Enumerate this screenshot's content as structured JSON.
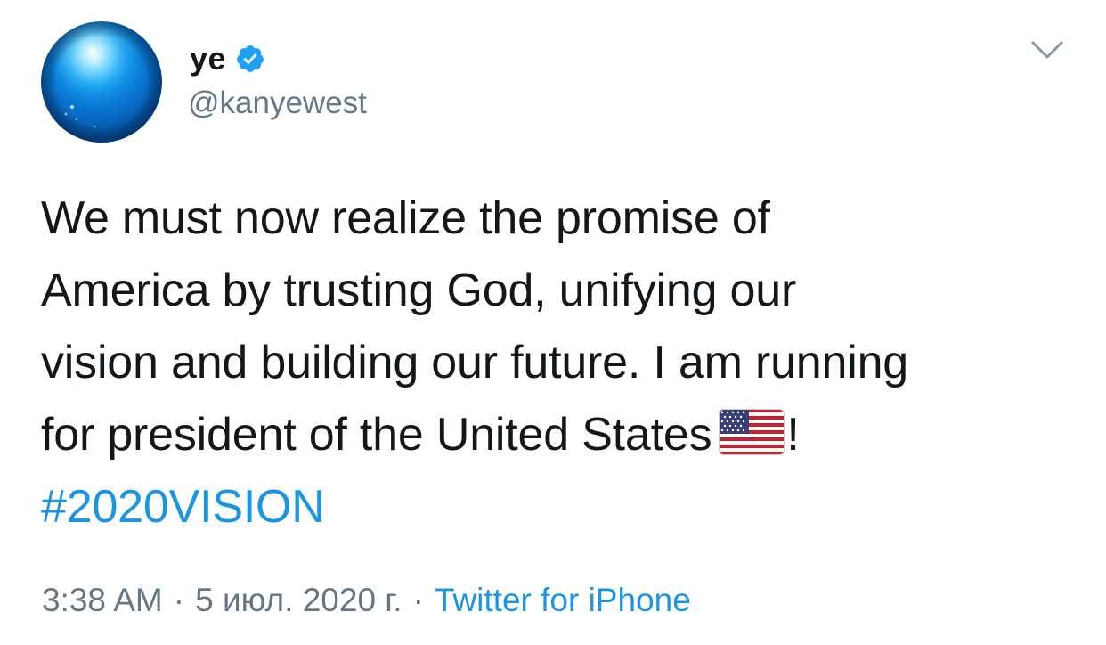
{
  "author": {
    "display_name": "ye",
    "handle": "@kanyewest",
    "verified": true,
    "avatar_icon": "blue-globe-avatar"
  },
  "tweet": {
    "lines": [
      "We must now realize the promise of",
      "America by trusting God, unifying our",
      "vision and building our future. I am running",
      "for president of the United States"
    ],
    "flag_emoji": "us-flag-icon",
    "trailing_punctuation": "!",
    "hashtag": "#2020VISION"
  },
  "meta": {
    "time": "3:38 AM",
    "date": "5 июл. 2020 г.",
    "separator": "·",
    "source": "Twitter for iPhone"
  },
  "colors": {
    "text": "#14171a",
    "secondary": "#657786",
    "link": "#1b95e0",
    "verified_badge": "#1da1f2",
    "caret": "#8899a6"
  }
}
